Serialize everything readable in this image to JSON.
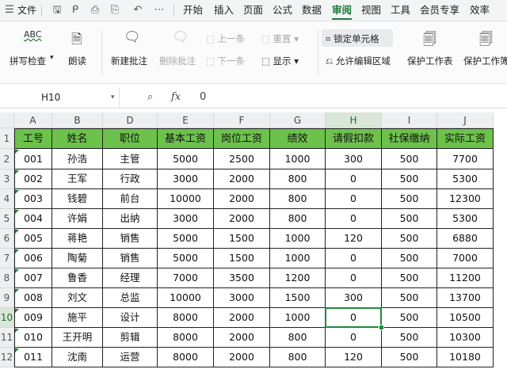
{
  "menubar": {
    "file_label": "文件",
    "tabs": [
      "开始",
      "插入",
      "页面",
      "公式",
      "数据",
      "审阅",
      "视图",
      "工具",
      "会员专享",
      "效率"
    ],
    "active_tab": "审阅"
  },
  "ribbon": {
    "spellcheck_label": "拼写检查",
    "read_aloud_label": "朗读",
    "new_comment_label": "新建批注",
    "delete_comment_label": "删除批注",
    "prev_label": "上一条",
    "next_label": "下一条",
    "reset_label": "重置",
    "show_label": "显示",
    "lock_cells_label": "锁定单元格",
    "allow_edit_label": "允许编辑区域",
    "protect_sheet_label": "保护工作表",
    "protect_book_label": "保护工作簿"
  },
  "formula_bar": {
    "cell_ref": "H10",
    "fx_label": "fx",
    "value": "0"
  },
  "sheet": {
    "col_letters": [
      "A",
      "B",
      "D",
      "E",
      "F",
      "G",
      "H",
      "I",
      "J"
    ],
    "row_numbers": [
      "1",
      "2",
      "3",
      "4",
      "5",
      "6",
      "7",
      "8",
      "9",
      "10",
      "11",
      "12"
    ],
    "headers": [
      "工号",
      "姓名",
      "职位",
      "基本工资",
      "岗位工资",
      "绩效",
      "请假扣款",
      "社保缴纳",
      "实际工资"
    ],
    "rows": [
      [
        "001",
        "孙浩",
        "主管",
        "5000",
        "2500",
        "1000",
        "300",
        "500",
        "7700"
      ],
      [
        "002",
        "王军",
        "行政",
        "3000",
        "2000",
        "800",
        "0",
        "500",
        "5300"
      ],
      [
        "003",
        "钱碧",
        "前台",
        "10000",
        "2000",
        "800",
        "0",
        "500",
        "12300"
      ],
      [
        "004",
        "许娟",
        "出纳",
        "3000",
        "2000",
        "800",
        "0",
        "500",
        "5300"
      ],
      [
        "005",
        "蒋艳",
        "销售",
        "5000",
        "1500",
        "1000",
        "120",
        "500",
        "6880"
      ],
      [
        "006",
        "陶菊",
        "销售",
        "5000",
        "1500",
        "1000",
        "0",
        "500",
        "7000"
      ],
      [
        "007",
        "鲁香",
        "经理",
        "7000",
        "3500",
        "1200",
        "0",
        "500",
        "11200"
      ],
      [
        "008",
        "刘文",
        "总监",
        "10000",
        "3000",
        "1500",
        "300",
        "500",
        "13700"
      ],
      [
        "009",
        "施平",
        "设计",
        "8000",
        "2000",
        "1000",
        "0",
        "500",
        "10500"
      ],
      [
        "010",
        "王开明",
        "剪辑",
        "8000",
        "2000",
        "800",
        "0",
        "500",
        "10300"
      ],
      [
        "011",
        "沈南",
        "运营",
        "8000",
        "2000",
        "800",
        "120",
        "500",
        "10180"
      ]
    ],
    "selected_cell": "H10",
    "header_color": "#6cc24a",
    "accent_color": "#1f8a3c"
  }
}
